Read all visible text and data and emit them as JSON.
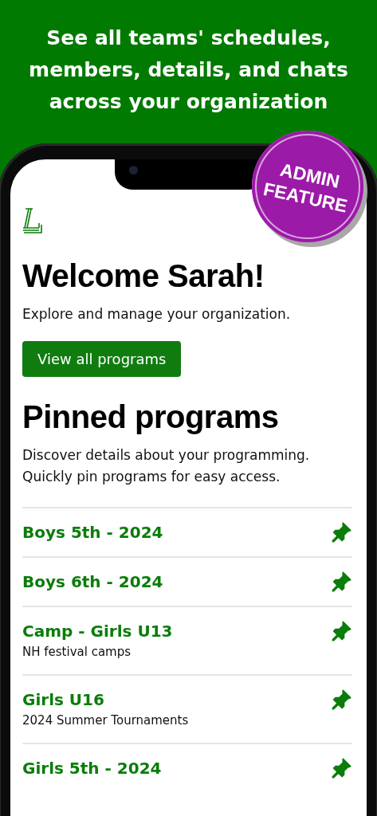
{
  "banner": {
    "title": "See all teams' schedules, members, details, and chats across your organization"
  },
  "badge": {
    "text": "ADMIN FEATURE"
  },
  "welcome": {
    "title": "Welcome Sarah!",
    "subtitle": "Explore and manage your organization.",
    "button": "View all programs"
  },
  "pinned": {
    "title": "Pinned programs",
    "description": "Discover details about your programming. Quickly pin programs for easy access.",
    "programs": [
      {
        "name": "Boys 5th - 2024",
        "pinned": true
      },
      {
        "name": "Boys 6th - 2024",
        "pinned": true
      },
      {
        "name": "Camp - Girls U13",
        "subtitle": "NH festival camps",
        "pinned": true
      },
      {
        "name": "Girls U16",
        "subtitle": "2024 Summer Tournaments",
        "pinned": true
      },
      {
        "name": "Girls 5th - 2024",
        "pinned": true
      }
    ]
  }
}
